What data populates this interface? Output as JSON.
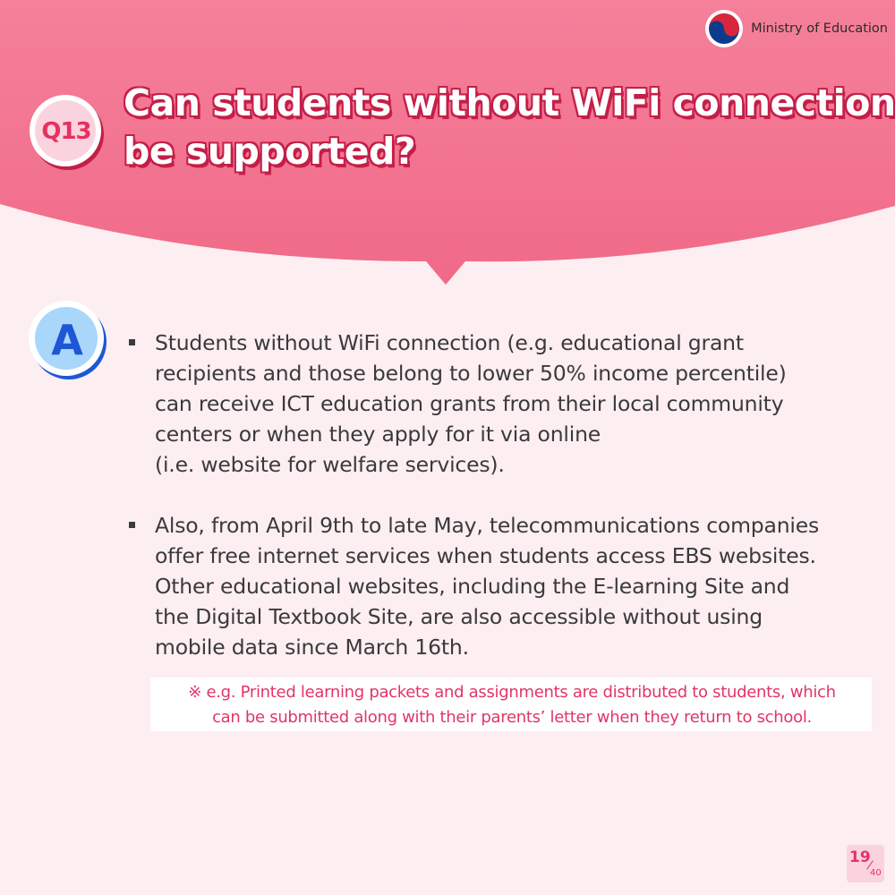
{
  "brand": {
    "name": "Ministry of Education",
    "logo_icon": "taegeuk-emblem-icon"
  },
  "question": {
    "badge": "Q13",
    "title_lines": [
      "Can students without WiFi connection",
      "be supported?"
    ]
  },
  "answer": {
    "badge": "A",
    "bullets": [
      {
        "lines": [
          "Students without WiFi connection (e.g. educational grant",
          "recipients and those belong to lower 50% income percentile)",
          "can receive ICT education grants from their local community",
          "centers or when they apply for it via online",
          "(i.e. website for welfare services)."
        ]
      },
      {
        "lines": [
          "Also, from April 9th to late May, telecommunications companies",
          "offer free internet services when students access EBS websites.",
          "Other educational websites, including the E-learning Site and",
          "the Digital Textbook Site, are also accessible without using",
          "mobile data since March 16th."
        ]
      }
    ],
    "note_lines": [
      "※ e.g. Printed learning packets and assignments are distributed to students, which",
      "can be submitted along with their parents’  letter when they return to school."
    ]
  },
  "page": {
    "current": "19",
    "total": "40"
  },
  "colors": {
    "header_pink": "#f2758f",
    "title_outline": "#c41f48",
    "background": "#fdeef1",
    "answer_blue": "#1d57d6",
    "note_text": "#e23566"
  }
}
